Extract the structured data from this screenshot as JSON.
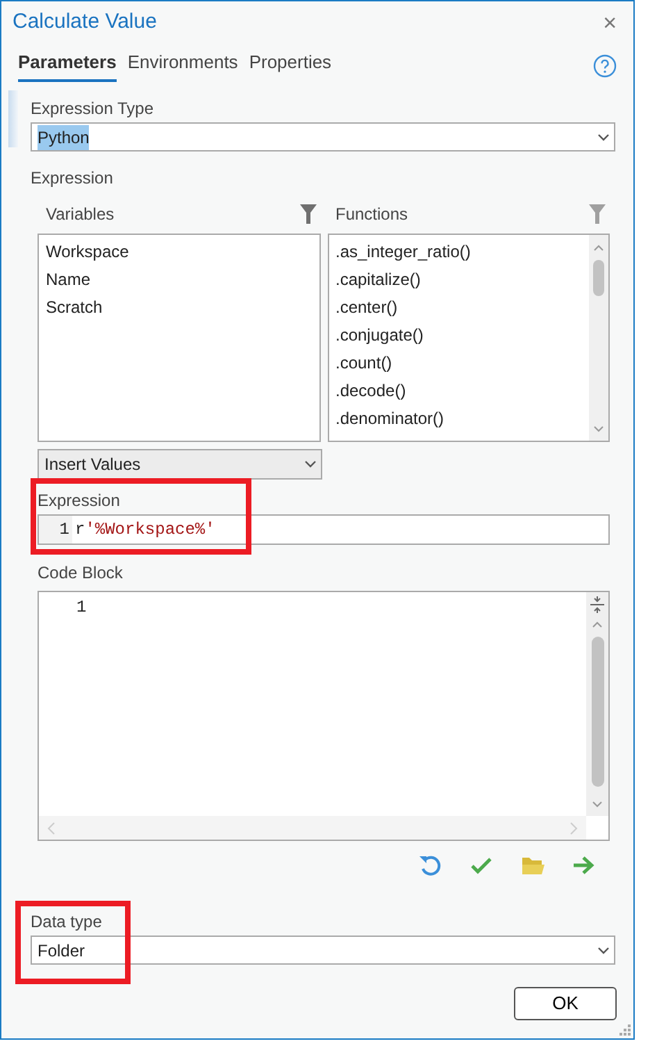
{
  "window": {
    "title": "Calculate Value",
    "close": "×"
  },
  "tabs": [
    {
      "label": "Parameters",
      "selected": true
    },
    {
      "label": "Environments",
      "selected": false
    },
    {
      "label": "Properties",
      "selected": false
    }
  ],
  "expression_type": {
    "label": "Expression Type",
    "value": "Python",
    "text_selected": true
  },
  "expression_group": {
    "label": "Expression"
  },
  "variables": {
    "label": "Variables",
    "items": [
      "Workspace",
      "Name",
      "Scratch"
    ]
  },
  "functions": {
    "label": "Functions",
    "items": [
      ".as_integer_ratio()",
      ".capitalize()",
      ".center()",
      ".conjugate()",
      ".count()",
      ".decode()",
      ".denominator()"
    ]
  },
  "insert_values": {
    "value": "Insert Values"
  },
  "expression": {
    "label": "Expression",
    "line_number": "1",
    "tokens": [
      {
        "text": "r",
        "kind": "prefix"
      },
      {
        "text": "'%Workspace%'",
        "kind": "string"
      }
    ],
    "highlighted": true
  },
  "code_block": {
    "label": "Code Block",
    "line_number": "1"
  },
  "data_type": {
    "label": "Data type",
    "value": "Folder",
    "highlighted": true
  },
  "buttons": [
    "OK"
  ]
}
